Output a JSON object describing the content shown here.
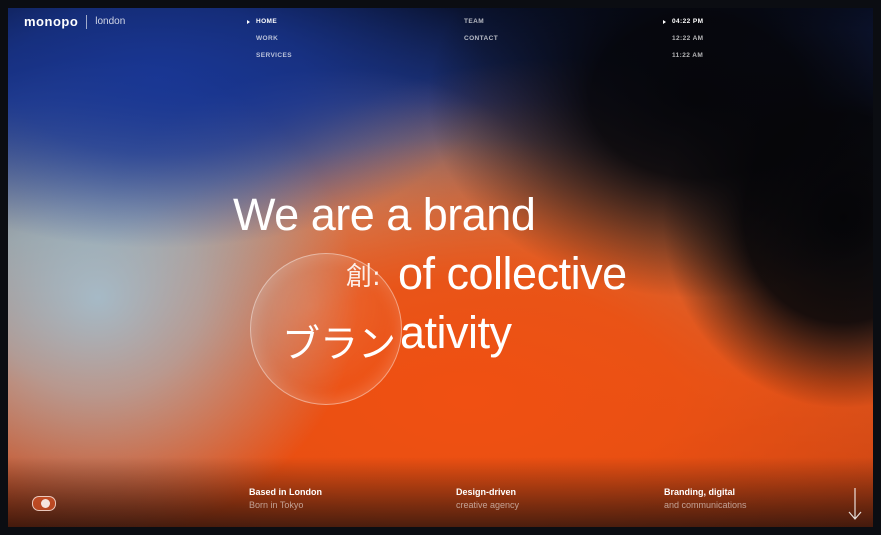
{
  "logo": {
    "brand": "monopo",
    "city": "london"
  },
  "nav": {
    "col1": [
      {
        "label": "HOME",
        "active": true
      },
      {
        "label": "WORK",
        "active": false
      },
      {
        "label": "SERVICES",
        "active": false
      }
    ],
    "col2": [
      {
        "label": "TEAM",
        "active": false
      },
      {
        "label": "CONTACT",
        "active": false
      }
    ],
    "col3": [
      {
        "label": "04:22 PM",
        "active": true
      },
      {
        "label": "12:22 AM",
        "active": false
      },
      {
        "label": "11:22 AM",
        "active": false
      }
    ]
  },
  "hero": {
    "line1": "We are a brand",
    "line2": "of collective",
    "line3": "ativity",
    "jp_lens_char": "創:",
    "jp_lens_word": "ブラン"
  },
  "footer": {
    "col1": {
      "strong": "Based in London",
      "muted": "Born in Tokyo"
    },
    "col2": {
      "strong": "Design-driven",
      "muted": "creative agency"
    },
    "col3": {
      "strong": "Branding, digital",
      "muted": "and communications"
    }
  },
  "icons": {
    "sound_toggle": "toggle-icon",
    "scroll": "arrow-down-icon"
  },
  "colors": {
    "accent_orange": "#e8541a",
    "deep_blue": "#1b2f70",
    "black": "#050508"
  }
}
